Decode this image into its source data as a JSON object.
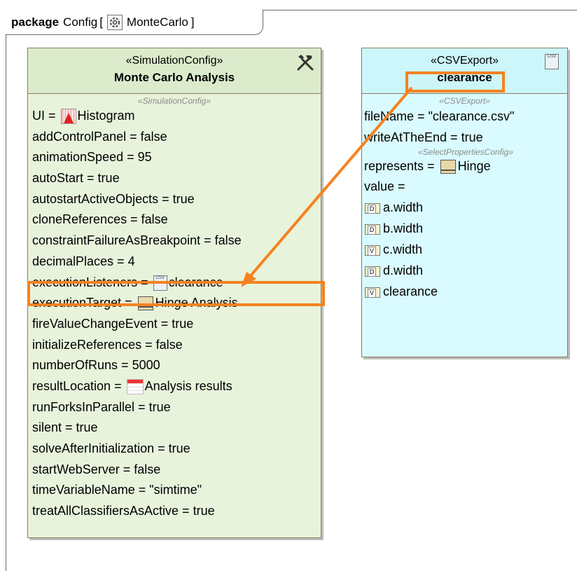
{
  "package": {
    "keyword": "package",
    "name": "Config",
    "bracket_open": "[",
    "diagram_name": "MonteCarlo",
    "bracket_close": "]"
  },
  "sim_block": {
    "stereotype": "«SimulationConfig»",
    "name": "Monte Carlo Analysis",
    "compartment_stereotype": "«SimulationConfig»",
    "properties": [
      {
        "text": "UI = ",
        "icon": "histogram-icon",
        "value": "Histogram"
      },
      {
        "text": "addControlPanel = false"
      },
      {
        "text": "animationSpeed = 95"
      },
      {
        "text": "autoStart = true"
      },
      {
        "text": "autostartActiveObjects = true"
      },
      {
        "text": "cloneReferences = false"
      },
      {
        "text": "constraintFailureAsBreakpoint = false"
      },
      {
        "text": "decimalPlaces = 4"
      },
      {
        "text": "executionListeners = ",
        "icon": "csv-icon",
        "value": "clearance"
      },
      {
        "text": "executionTarget = ",
        "icon": "part-icon",
        "value": "Hinge Analysis"
      },
      {
        "text": "fireValueChangeEvent = true"
      },
      {
        "text": "initializeReferences = false"
      },
      {
        "text": "numberOfRuns = 5000"
      },
      {
        "text": "resultLocation = ",
        "icon": "table-icon",
        "value": "Analysis results"
      },
      {
        "text": "runForksInParallel = true"
      },
      {
        "text": "silent = true"
      },
      {
        "text": "solveAfterInitialization = true"
      },
      {
        "text": "startWebServer = false"
      },
      {
        "text": "timeVariableName = \"simtime\""
      },
      {
        "text": "treatAllClassifiersAsActive = true"
      }
    ]
  },
  "csv_block": {
    "stereotype": "«CSVExport»",
    "name": "clearance",
    "compartment_stereotype": "«CSVExport»",
    "props1": [
      "fileName = \"clearance.csv\"",
      "writeAtTheEnd = true"
    ],
    "compartment_stereotype2": "«SelectPropertiesConfig»",
    "represents_label": "represents = ",
    "represents_value": "Hinge",
    "value_label": "value =",
    "values": [
      {
        "badge": "D",
        "name": "a.width"
      },
      {
        "badge": "D",
        "name": "b.width"
      },
      {
        "badge": "V",
        "name": "c.width"
      },
      {
        "badge": "D",
        "name": "d.width"
      },
      {
        "badge": "V",
        "name": "clearance"
      }
    ]
  },
  "colors": {
    "highlight": "#f58220",
    "sim_fill": "#e8f3dc",
    "csv_fill": "#d9fbff"
  },
  "icons": {
    "csv_text": "CSV"
  }
}
